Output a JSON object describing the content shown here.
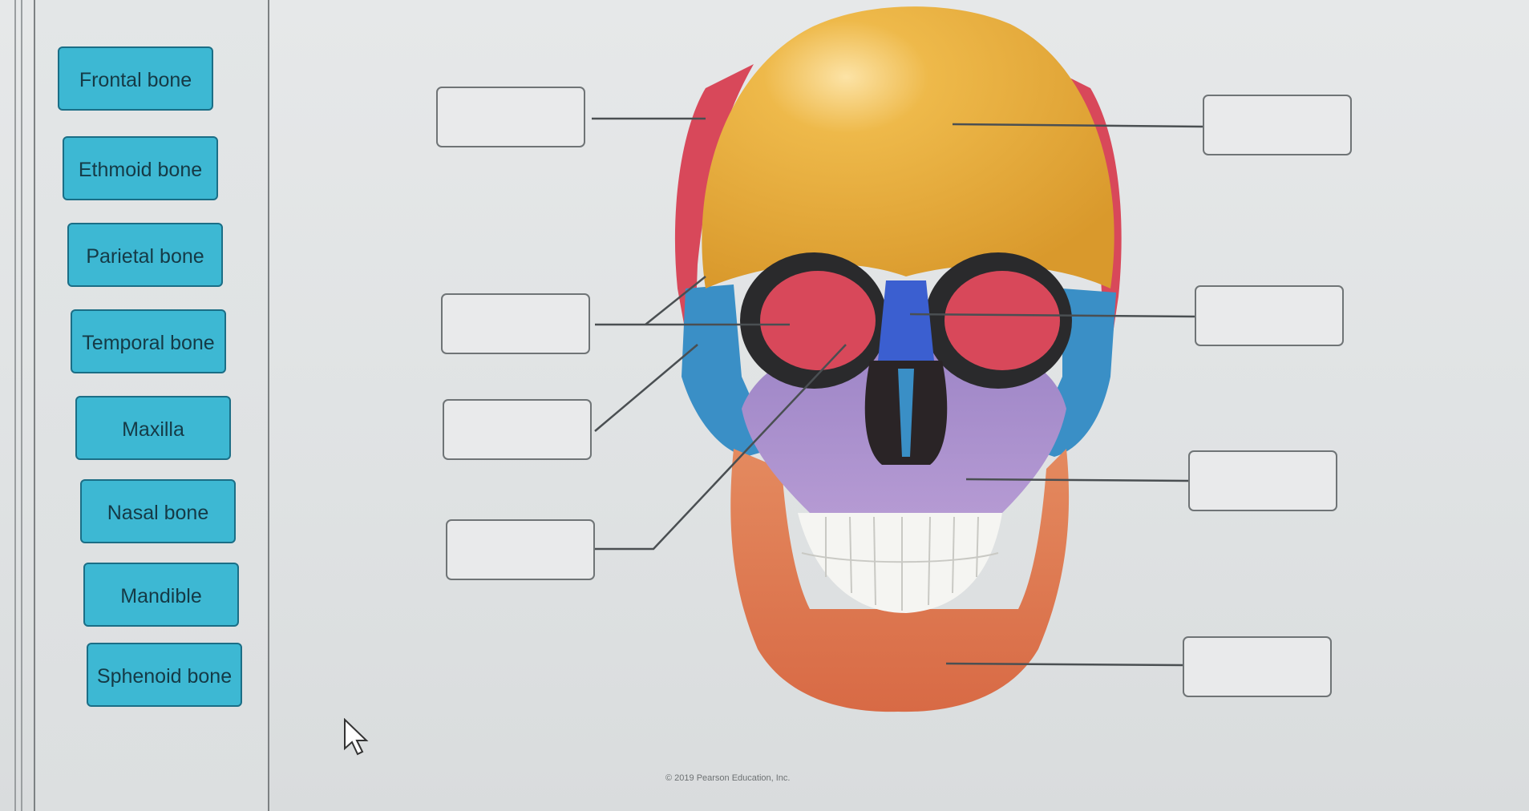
{
  "label_tiles": [
    {
      "id": "frontal",
      "label": "Frontal bone"
    },
    {
      "id": "ethmoid",
      "label": "Ethmoid bone"
    },
    {
      "id": "parietal",
      "label": "Parietal bone"
    },
    {
      "id": "temporal",
      "label": "Temporal bone"
    },
    {
      "id": "maxilla",
      "label": "Maxilla"
    },
    {
      "id": "nasal",
      "label": "Nasal bone"
    },
    {
      "id": "mandible",
      "label": "Mandible"
    },
    {
      "id": "sphenoid",
      "label": "Sphenoid bone"
    }
  ],
  "drop_targets": [
    "",
    "",
    "",
    "",
    "",
    "",
    "",
    ""
  ],
  "footer": {
    "copyright": "© 2019 Pearson Education, Inc."
  },
  "colors": {
    "tile_fill": "#3db8d3",
    "frontal": "#e8b13d",
    "parietal": "#d8485a",
    "sphenoid": "#3a8fc6",
    "maxilla": "#a68bc8",
    "mandible": "#e07a52",
    "nasal": "#3b5fd0"
  },
  "icons": {
    "cursor": "mouse-pointer-icon"
  }
}
